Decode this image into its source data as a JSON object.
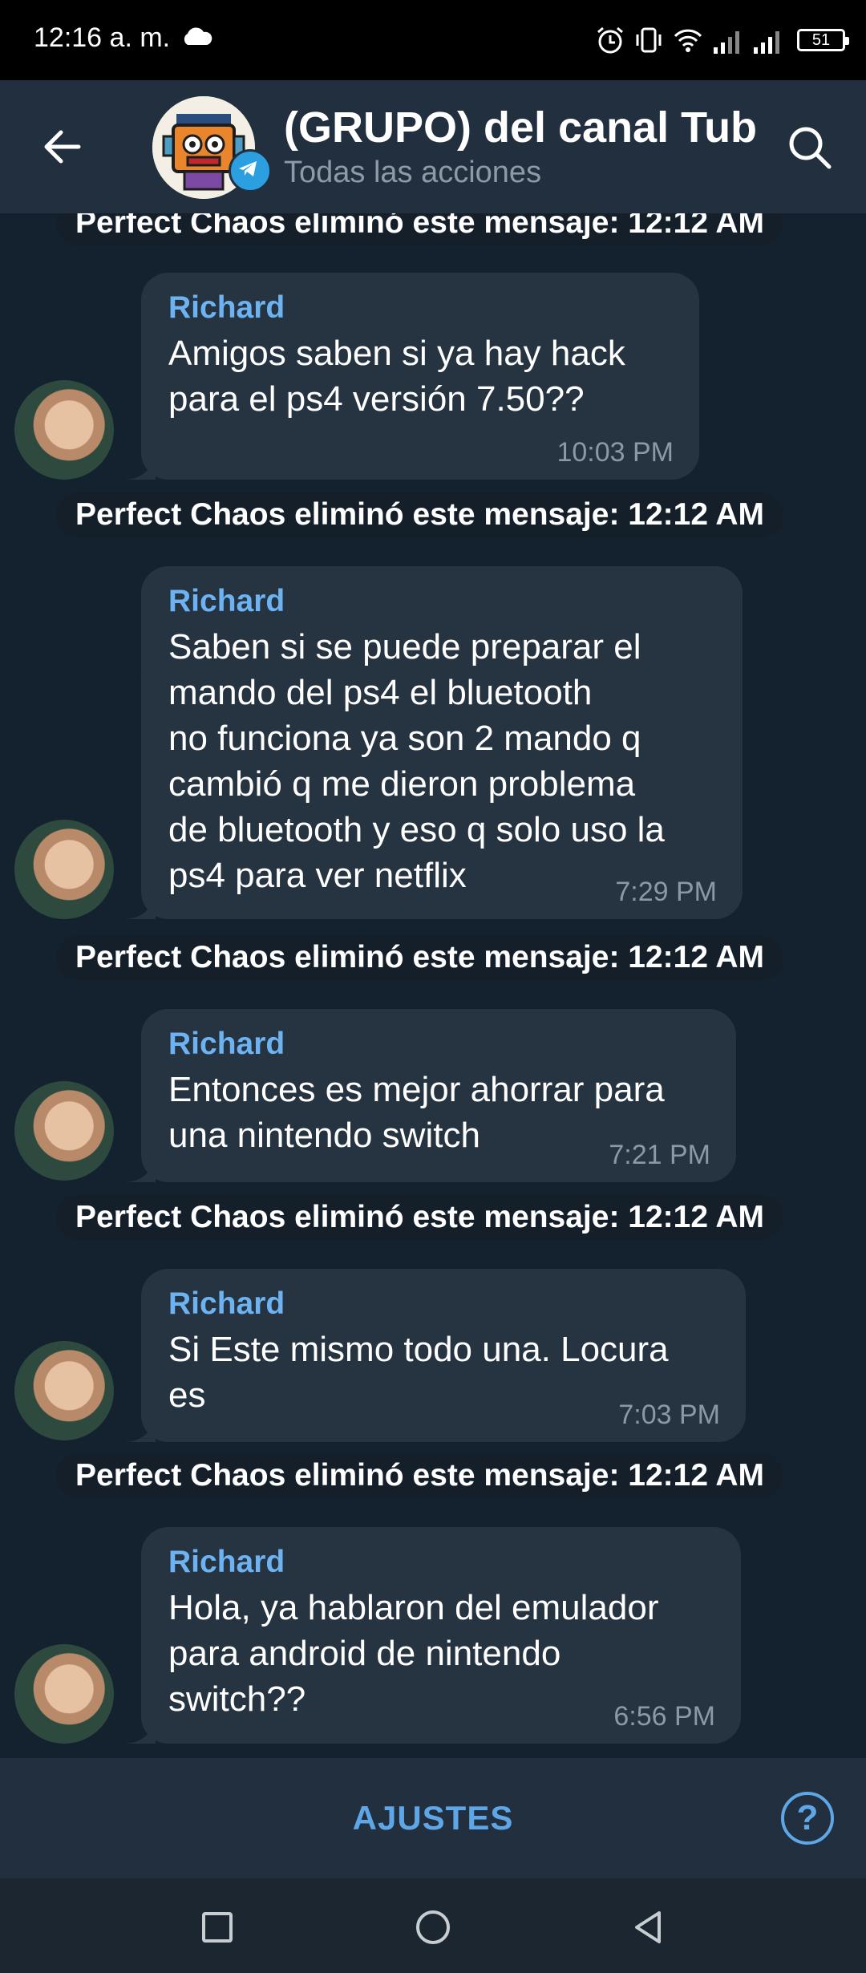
{
  "status_bar": {
    "time": "12:16 a. m.",
    "battery": "51"
  },
  "header": {
    "title": "(GRUPO) del canal Tube",
    "subtitle": "Todas las acciones"
  },
  "messages": [
    {
      "system": "Perfect Chaos eliminó este mensaje:  12:12 AM",
      "sender": "Richard",
      "text": "Amigos saben si ya hay hack\npara el ps4 versión 7.50??",
      "time": "10:03 PM"
    },
    {
      "system": "Perfect Chaos eliminó este mensaje:  12:12 AM",
      "sender": "Richard",
      "text": "Saben si se puede preparar el\nmando del ps4 el bluetooth\nno funciona ya son 2 mando q\ncambió q me dieron problema\nde bluetooth y eso q solo uso la\nps4 para ver netflix",
      "time": "7:29 PM"
    },
    {
      "system": "Perfect Chaos eliminó este mensaje:  12:12 AM",
      "sender": "Richard",
      "text": "Entonces es mejor ahorrar para\nuna nintendo switch",
      "time": "7:21 PM"
    },
    {
      "system": "Perfect Chaos eliminó este mensaje:  12:12 AM",
      "sender": "Richard",
      "text": "Si Este mismo todo una. Locura\nes",
      "time": "7:03 PM"
    },
    {
      "system": "Perfect Chaos eliminó este mensaje:  12:12 AM",
      "sender": "Richard",
      "text": "Hola,  ya hablaron del emulador\npara android de nintendo\nswitch??",
      "time": "6:56 PM"
    }
  ],
  "bottom_bar": {
    "action_label": "AJUSTES",
    "help_label": "?"
  },
  "colors": {
    "accent": "#5ea6e6",
    "sender": "#6db3f2",
    "bubble": "#263341",
    "header": "#222f3e"
  }
}
